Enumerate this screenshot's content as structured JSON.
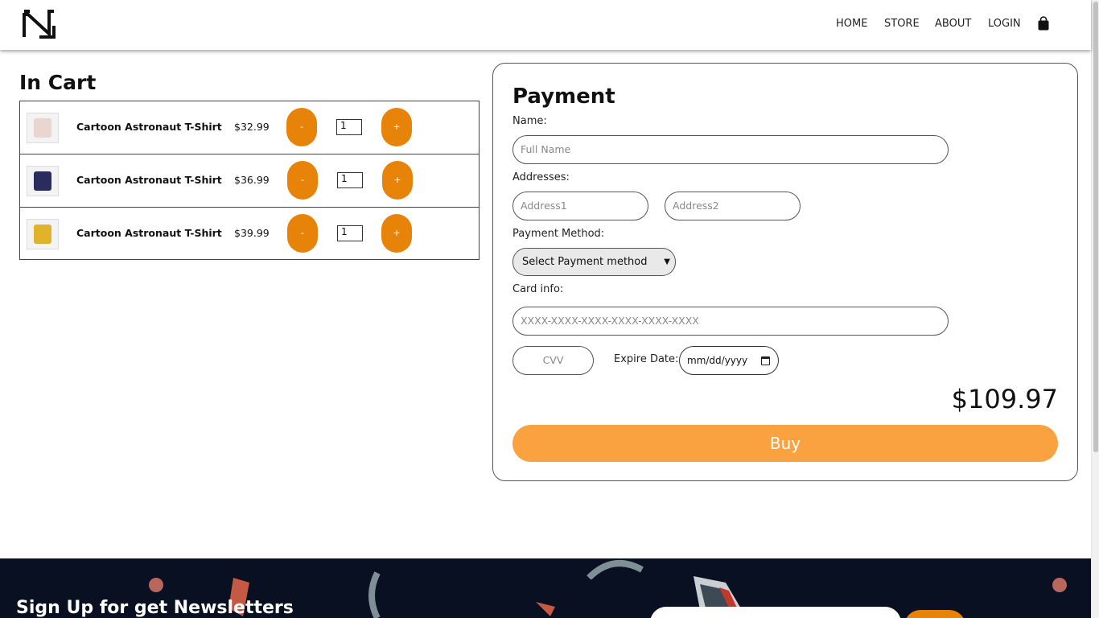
{
  "header": {
    "logo_icon": "brand-logo",
    "nav": [
      "HOME",
      "STORE",
      "ABOUT",
      "LOGIN"
    ],
    "cart_icon": "shopping-bag-icon"
  },
  "cart": {
    "title": "In Cart",
    "items": [
      {
        "name": "Cartoon Astronaut T-Shirt",
        "price": "$32.99",
        "qty": "1",
        "minus": "-",
        "plus": "+",
        "swatch": "#e9d6d0"
      },
      {
        "name": "Cartoon Astronaut T-Shirt",
        "price": "$36.99",
        "qty": "1",
        "minus": "-",
        "plus": "+",
        "swatch": "#2b2c5e"
      },
      {
        "name": "Cartoon Astronaut T-Shirt",
        "price": "$39.99",
        "qty": "1",
        "minus": "-",
        "plus": "+",
        "swatch": "#e0b32a"
      }
    ]
  },
  "payment": {
    "title": "Payment",
    "name_label": "Name:",
    "name_placeholder": "Full Name",
    "address_label": "Addresses:",
    "address1_placeholder": "Address1",
    "address2_placeholder": "Address2",
    "method_label": "Payment Method:",
    "method_selected": "Select Payment method",
    "card_label": "Card info:",
    "card_placeholder": "XXXX-XXXX-XXXX-XXXX-XXXX-XXXX",
    "cvv_placeholder": "CVV",
    "expire_label": "Expire Date:",
    "expire_value": "mm/dd/yyyy",
    "total": "$109.97",
    "buy_label": "Buy"
  },
  "footer": {
    "title": "Sign Up for get Newsletters"
  },
  "colors": {
    "accent": "#e8830a",
    "buy": "#fba240",
    "footer_bg": "#081022"
  }
}
